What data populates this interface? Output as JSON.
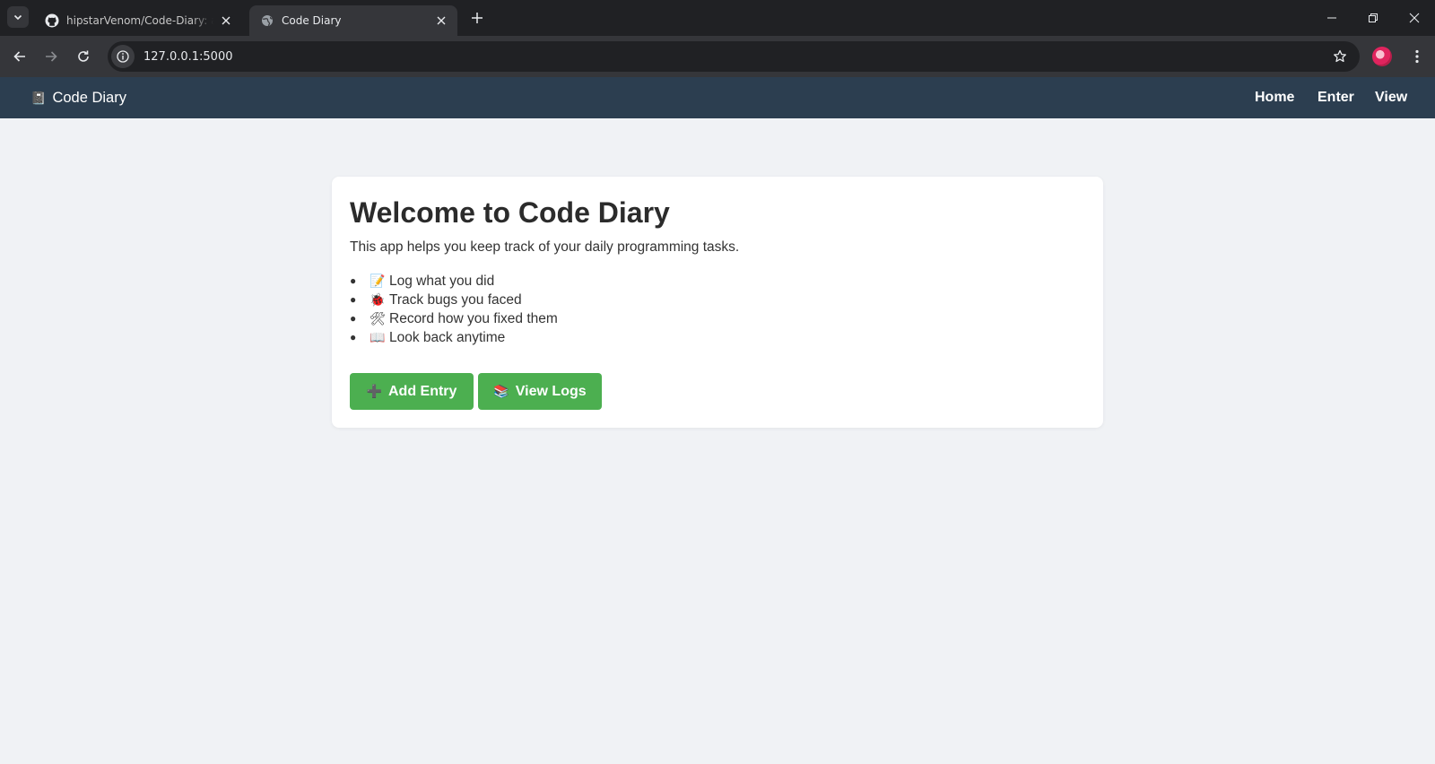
{
  "browser": {
    "tabs": [
      {
        "title": "hipstarVenom/Code-Diary: a simple",
        "favicon": "github-icon",
        "active": false
      },
      {
        "title": "Code Diary",
        "favicon": "globe-icon",
        "active": true
      }
    ],
    "url": "127.0.0.1:5000"
  },
  "app": {
    "brand": {
      "icon": "📓",
      "title": "Code Diary"
    },
    "nav": {
      "home": "Home",
      "enter": "Enter",
      "view": "View"
    },
    "card": {
      "title": "Welcome to Code Diary",
      "intro": "This app helps you keep track of your daily programming tasks.",
      "features": [
        {
          "icon": "📝",
          "text": "Log what you did"
        },
        {
          "icon": "🐞",
          "text": "Track bugs you faced"
        },
        {
          "icon": "🛠",
          "text": "Record how you fixed them"
        },
        {
          "icon": "📖",
          "text": "Look back anytime"
        }
      ],
      "buttons": {
        "add": {
          "icon": "➕",
          "label": "Add Entry"
        },
        "view": {
          "icon": "📚",
          "label": "View Logs"
        }
      }
    }
  },
  "colors": {
    "navbar": "#2c3e50",
    "page_bg": "#f0f2f5",
    "button": "#4caf50"
  }
}
